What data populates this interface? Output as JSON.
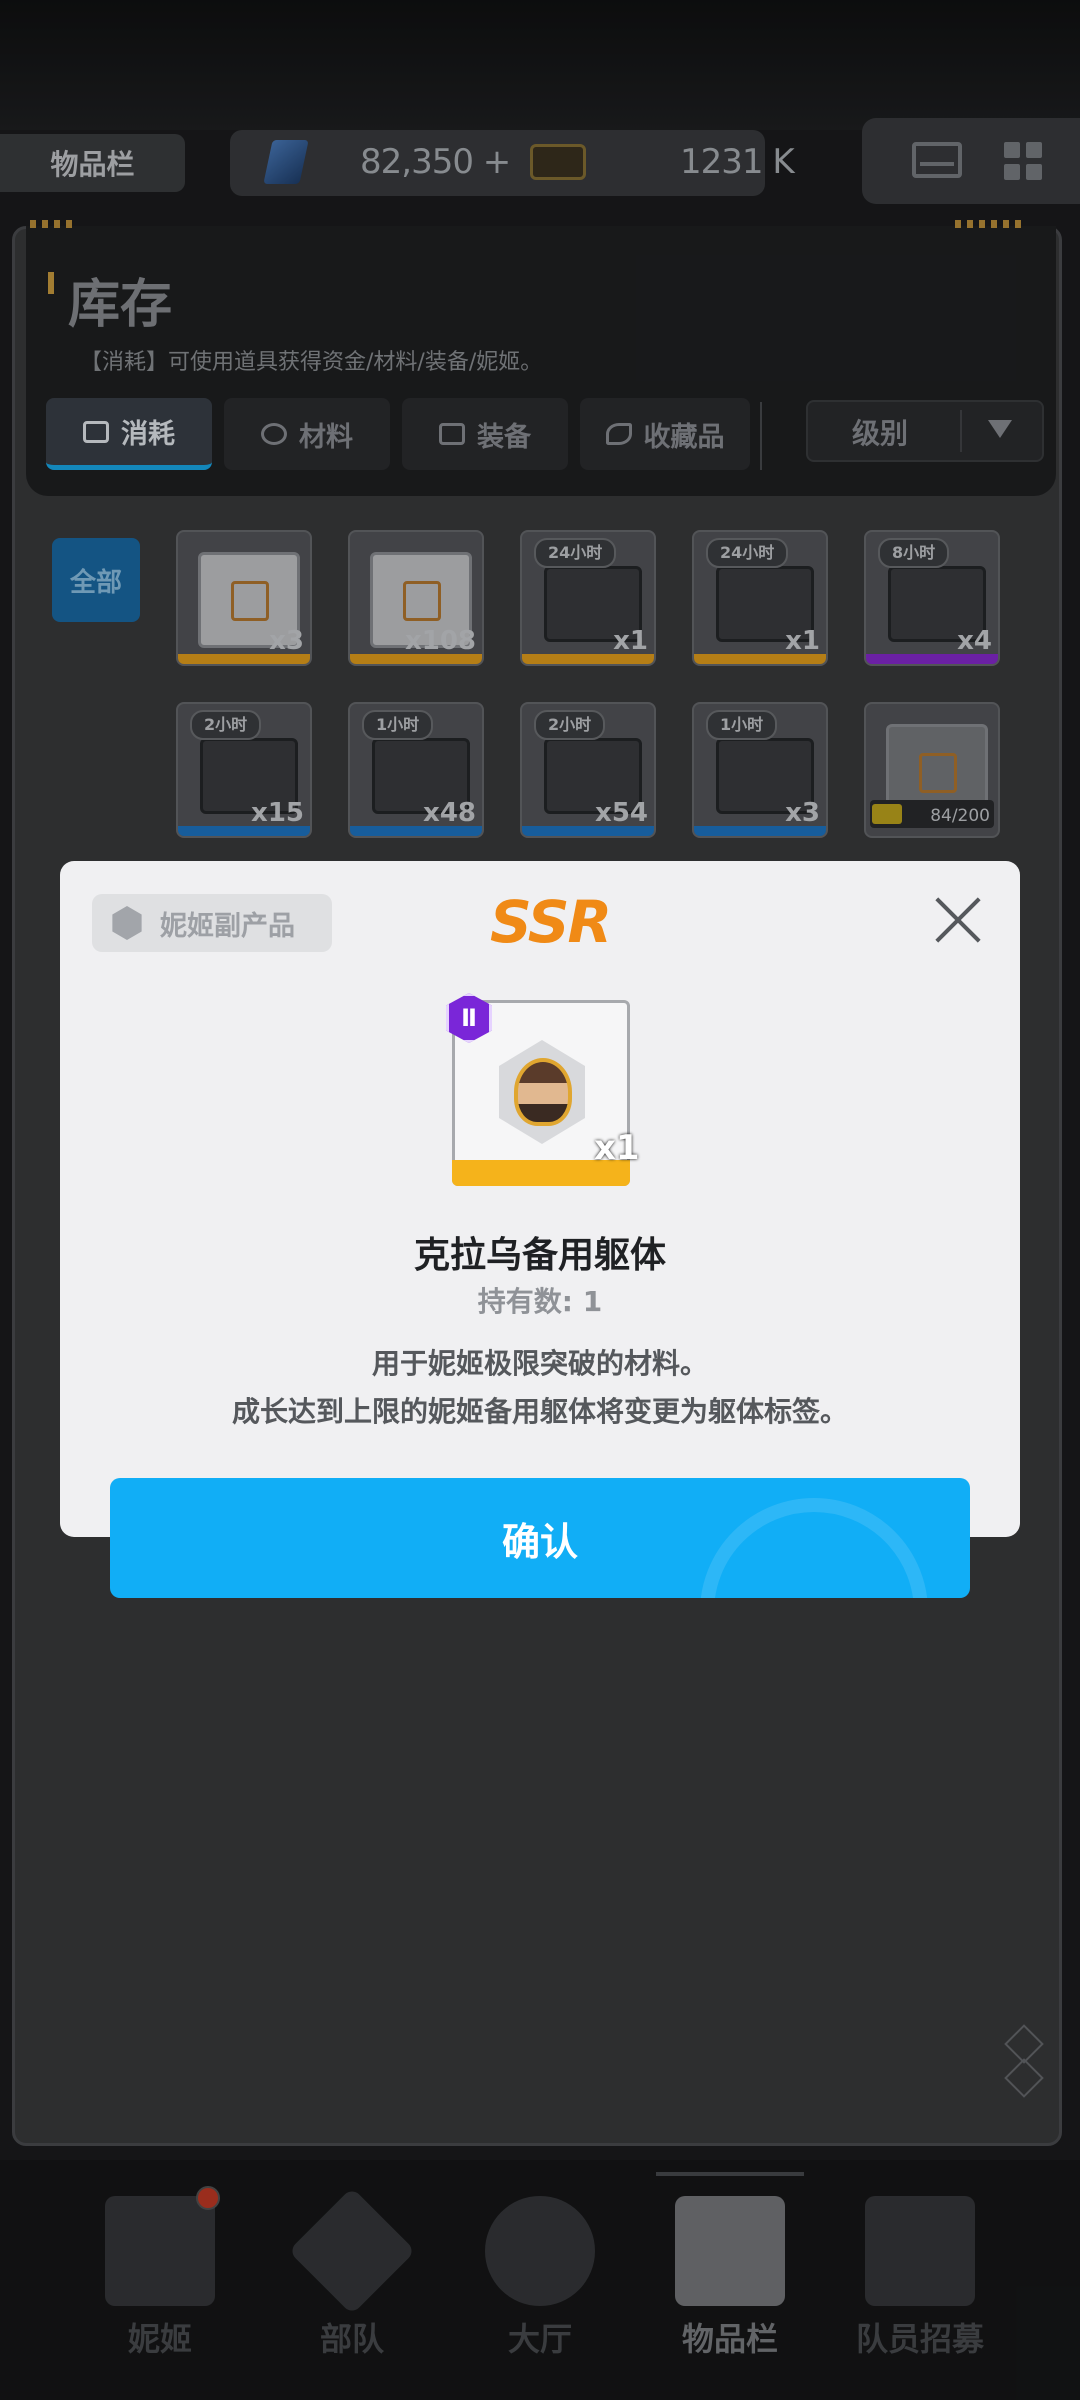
{
  "header": {
    "title": "物品栏",
    "currency1": "82,350 +",
    "currency2": "1231 K"
  },
  "inventory": {
    "title": "库存",
    "description": "【消耗】可使用道具获得资金/材料/装备/妮姬。",
    "tabs": [
      {
        "label": "消耗",
        "icon": "consumable-icon"
      },
      {
        "label": "材料",
        "icon": "gear-icon"
      },
      {
        "label": "装备",
        "icon": "bag-icon"
      },
      {
        "label": "收藏品",
        "icon": "bird-icon"
      }
    ],
    "sort_label": "级别",
    "filter_all": "全部",
    "items_row1": [
      {
        "count": "x3",
        "timer": "",
        "rarity_color": "#e8a21d"
      },
      {
        "count": "x108",
        "timer": "",
        "rarity_color": "#e8a21d"
      },
      {
        "count": "x1",
        "timer": "24小时",
        "rarity_color": "#e8a21d"
      },
      {
        "count": "x1",
        "timer": "24小时",
        "rarity_color": "#e8a21d"
      },
      {
        "count": "x4",
        "timer": "8小时",
        "rarity_color": "#8a2ad2"
      }
    ],
    "items_row2": [
      {
        "count": "x15",
        "timer": "2小时",
        "rarity_color": "#1e78c8"
      },
      {
        "count": "x48",
        "timer": "1小时",
        "rarity_color": "#1e78c8"
      },
      {
        "count": "x54",
        "timer": "2小时",
        "rarity_color": "#1e78c8"
      },
      {
        "count": "x3",
        "timer": "1小时",
        "rarity_color": "#1e78c8"
      },
      {
        "count": "84/200",
        "timer": "",
        "rarity_color": "#6a6c70",
        "fill_fraction": 0.42
      }
    ]
  },
  "dialog": {
    "tag": "妮姬副产品",
    "rarity": "SSR",
    "item_level": "Ⅱ",
    "item_count": "x1",
    "item_name": "克拉乌备用躯体",
    "owned": "持有数: 1",
    "desc_line1": "用于妮姬极限突破的材料。",
    "desc_line2": "成长达到上限的妮姬备用躯体将变更为躯体标签。",
    "confirm": "确认"
  },
  "nav": {
    "items": [
      {
        "label": "妮姬"
      },
      {
        "label": "部队"
      },
      {
        "label": "大厅"
      },
      {
        "label": "物品栏"
      },
      {
        "label": "队员招募"
      }
    ]
  }
}
